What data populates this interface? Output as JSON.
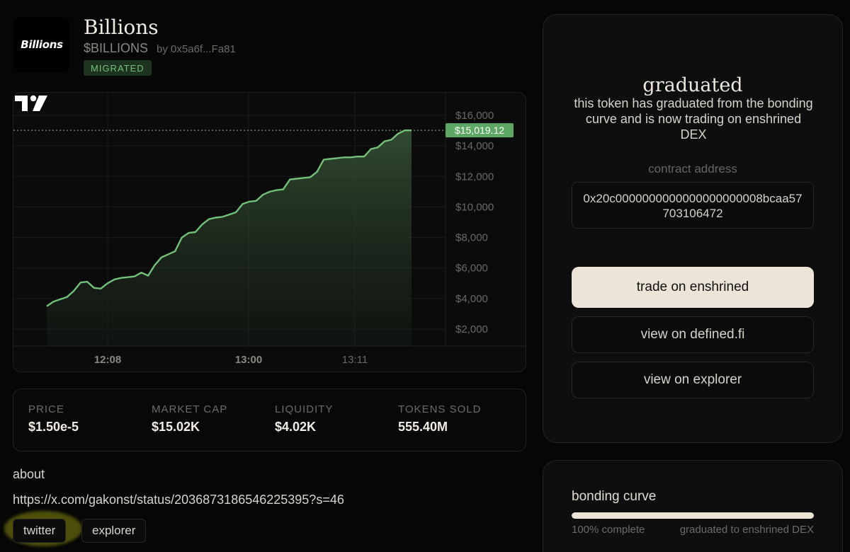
{
  "token": {
    "logo_text": "Billions",
    "name": "Billions",
    "ticker": "$BILLIONS",
    "creator": "by 0x5a6f...Fa81",
    "status_badge": "MIGRATED"
  },
  "colors": {
    "accent_green": "#72c07a",
    "badge_bg": "#1d3320",
    "primary_button": "#ebe4d7",
    "background": "#060606"
  },
  "chart_data": {
    "type": "area",
    "x_tick_labels": [
      "12:08",
      "13:00",
      "13:11"
    ],
    "y_ticks": [
      "$16,000",
      "$14,000",
      "$12,000",
      "$10,000",
      "$8,000",
      "$6,000",
      "$4,000",
      "$2,000"
    ],
    "ylim": [
      1000,
      17000
    ],
    "grid": true,
    "current_value_label": "$15,019.12",
    "current_value": 15019.12,
    "values": [
      3500,
      3800,
      3950,
      4100,
      4500,
      5050,
      5100,
      4700,
      4650,
      5000,
      5250,
      5350,
      5400,
      5450,
      5700,
      5500,
      6200,
      6700,
      6900,
      7100,
      8000,
      8300,
      8350,
      8850,
      9200,
      9300,
      9350,
      9500,
      9650,
      10200,
      10350,
      10400,
      10800,
      11000,
      11100,
      11150,
      11800,
      11850,
      11900,
      11950,
      12300,
      13100,
      13150,
      13200,
      13250,
      13250,
      13300,
      13300,
      13800,
      13900,
      14300,
      14400,
      14800,
      15019.12,
      15019.12
    ]
  },
  "chart_watermark_icon": "tradingview-logo-icon",
  "stats": [
    {
      "label": "PRICE",
      "value": "$1.50e-5"
    },
    {
      "label": "MARKET CAP",
      "value": "$15.02K"
    },
    {
      "label": "LIQUIDITY",
      "value": "$4.02K"
    },
    {
      "label": "TOKENS SOLD",
      "value": "555.40M"
    }
  ],
  "about": {
    "title": "about",
    "link": "https://x.com/gakonst/status/2036873186546225395?s=46",
    "twitter_label": "twitter",
    "explorer_label": "explorer"
  },
  "graduated": {
    "title": "graduated",
    "description": "this token has graduated from the bonding curve and is now trading on enshrined DEX",
    "contract_label": "contract address",
    "contract_address": "0x20c0000000000000000000008bcaa57703106472",
    "trade_button": "trade on enshrined",
    "defined_button": "view on defined.fi",
    "explorer_button": "view on explorer"
  },
  "bonding_curve": {
    "title": "bonding curve",
    "progress_percent": 100,
    "progress_label": "100% complete",
    "status": "graduated to enshrined DEX"
  }
}
